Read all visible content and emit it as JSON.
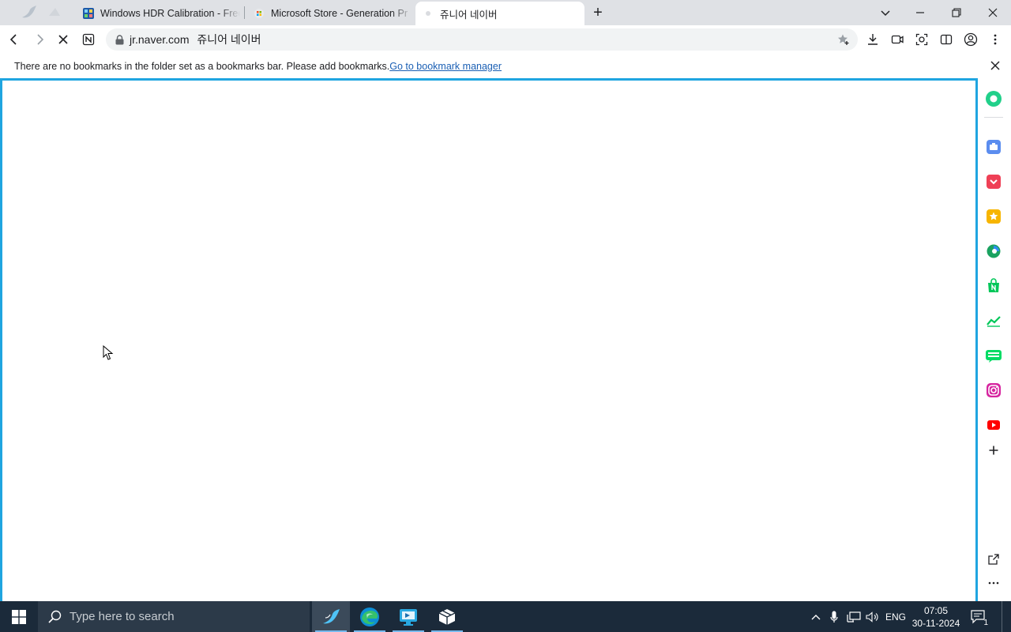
{
  "browser": {
    "tabs": [
      {
        "title": "Windows HDR Calibration - Free",
        "favicon": "windows-hdr-app-icon",
        "active": false
      },
      {
        "title": "Microsoft Store - Generation Pr",
        "favicon": "store-page-icon",
        "active": false
      },
      {
        "title": "쥬니어 네이버",
        "favicon": "loading-dot-icon",
        "active": true
      }
    ],
    "new_tab_label": "+",
    "address_bar": {
      "url": "jr.naver.com",
      "page_title": "쥬니어 네이버"
    },
    "infobar": {
      "message": "There are no bookmarks in the folder set as a bookmarks bar. Please add bookmarks.",
      "link": "Go to bookmark manager"
    }
  },
  "side_panel": {
    "icons": [
      "circle-app-icon",
      "briefcase-icon",
      "pocket-icon",
      "star-favorites-icon",
      "edge-drop-icon",
      "naver-shopping-icon",
      "chart-icon",
      "naver-webtoon-icon",
      "instagram-icon",
      "youtube-icon",
      "add-icon",
      "open-external-icon",
      "more-icon"
    ]
  },
  "taskbar": {
    "search_placeholder": "Type here to search",
    "tray": {
      "language": "ENG",
      "time": "07:05",
      "date": "30-11-2024",
      "notification_count": "1"
    }
  },
  "colors": {
    "content_border": "#1fa5e0",
    "taskbar_bg": "#1b2a3a",
    "tabstrip_bg": "#dfe1e5"
  }
}
